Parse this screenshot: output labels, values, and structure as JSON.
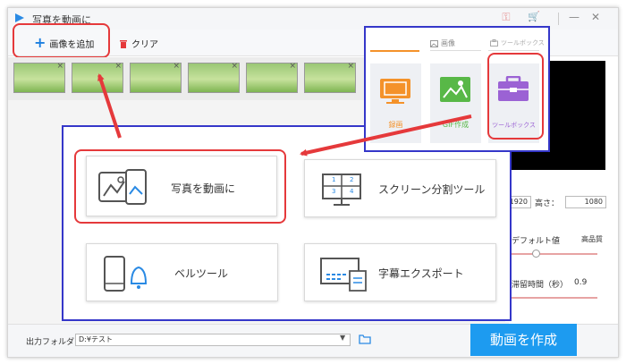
{
  "window": {
    "title": "写真を動画に",
    "key_icon": "⚿",
    "cart_icon": "🛒",
    "minimize": "—",
    "close": "✕"
  },
  "toolbar": {
    "add_label": "画像を追加",
    "add_icon": "+",
    "clear_label": "クリア"
  },
  "thumbnails": [
    {
      "close": "×"
    },
    {
      "close": "×"
    },
    {
      "close": "×"
    },
    {
      "close": "×"
    },
    {
      "close": "×"
    },
    {
      "close": "×"
    }
  ],
  "right_panel": {
    "width_value": "1920",
    "height_label": "高さ：",
    "height_value": "1080",
    "default_value_label": "デフォルト値",
    "high_quality_label": "高品質",
    "duration_label": "滞留時間（秒）",
    "duration_value": "0.9"
  },
  "bottom": {
    "output_label": "出力フォルダ：",
    "output_path": "D:¥テスト",
    "create_button": "動画を作成"
  },
  "popup": {
    "tools": [
      {
        "label": "写真を動画に"
      },
      {
        "label": "スクリーン分割ツール",
        "digits": [
          "1",
          "2",
          "3",
          "4"
        ]
      },
      {
        "label": "ベルツール"
      },
      {
        "label": "字幕エクスポート"
      }
    ]
  },
  "launcher": {
    "tab_image": "画像",
    "tab_toolbox": "ツールボックス",
    "tiles": [
      {
        "label": "録画",
        "color": "#f4922a"
      },
      {
        "label": "GIF作成",
        "color": "#58b847"
      },
      {
        "label": "ツールボックス",
        "color": "#9b62d4"
      }
    ]
  },
  "colors": {
    "annotation_red": "#e5393b",
    "annotation_blue": "#3537c9",
    "primary_button": "#1d9bf0"
  }
}
